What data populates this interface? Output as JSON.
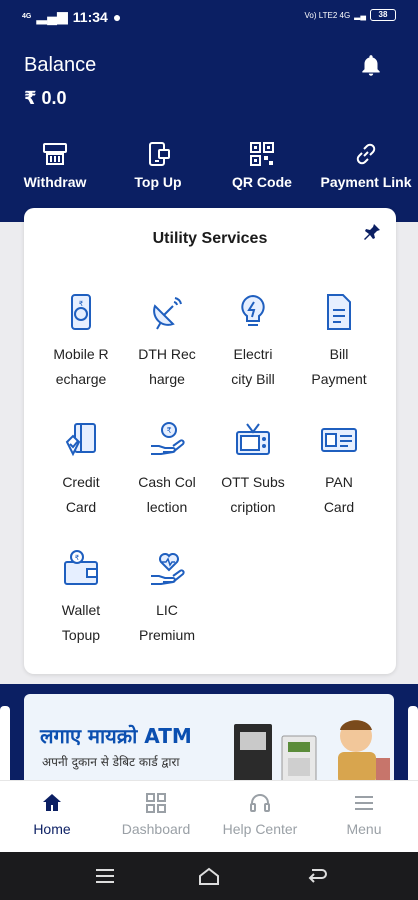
{
  "status_bar": {
    "time": "11:34",
    "network_left": "4G",
    "network_right": "Vo) LTE2 4G",
    "battery": "38"
  },
  "header": {
    "balance_label": "Balance",
    "balance_value": "₹  0.0"
  },
  "quick_actions": [
    {
      "label": "Withdraw",
      "icon": "bank-icon"
    },
    {
      "label": "Top Up",
      "icon": "topup-icon"
    },
    {
      "label": "QR Code",
      "icon": "qr-code-icon"
    },
    {
      "label": "Payment Link",
      "icon": "link-icon"
    }
  ],
  "utility": {
    "title": "Utility Services",
    "services": [
      {
        "line1": "Mobile R",
        "line2": "echarge",
        "icon": "mobile-icon"
      },
      {
        "line1": "DTH Rec",
        "line2": "harge",
        "icon": "satellite-dish-icon"
      },
      {
        "line1": "Electri",
        "line2": "city Bill",
        "icon": "bulb-icon"
      },
      {
        "line1": "Bill",
        "line2": "Payment",
        "icon": "bill-icon"
      },
      {
        "line1": "Credit",
        "line2": "Card",
        "icon": "credit-card-icon"
      },
      {
        "line1": "Cash Col",
        "line2": "lection",
        "icon": "cash-hand-icon"
      },
      {
        "line1": "OTT Subs",
        "line2": "cription",
        "icon": "tv-icon"
      },
      {
        "line1": "PAN",
        "line2": "Card",
        "icon": "id-card-icon"
      },
      {
        "line1": "Wallet",
        "line2": "Topup",
        "icon": "wallet-icon"
      },
      {
        "line1": "LIC",
        "line2": "Premium",
        "icon": "heart-hand-icon"
      }
    ]
  },
  "banner": {
    "headline": "लगाए मायक्रो ATM",
    "subline": "अपनी दुकान से डेबिट कार्ड द्वारा"
  },
  "bottom_nav": [
    {
      "label": "Home",
      "icon": "home-icon",
      "active": true
    },
    {
      "label": "Dashboard",
      "icon": "dashboard-icon",
      "active": false
    },
    {
      "label": "Help Center",
      "icon": "headset-icon",
      "active": false
    },
    {
      "label": "Menu",
      "icon": "menu-icon",
      "active": false
    }
  ],
  "colors": {
    "primary": "#0b1f63",
    "icon_blue": "#1f5fbf",
    "inactive": "#9aa0a6"
  }
}
